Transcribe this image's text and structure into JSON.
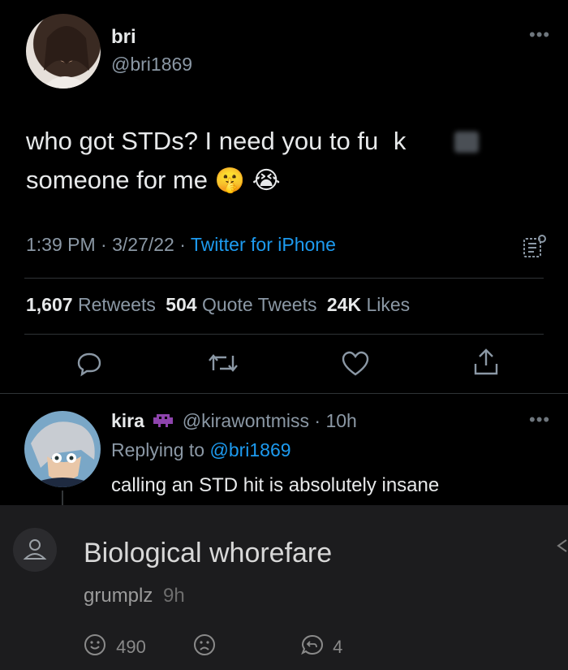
{
  "tweet": {
    "author_name": "bri",
    "author_handle": "@bri1869",
    "text_line1": "who got STDs? I need you to fu   k",
    "text_line2": "someone for me",
    "emoji": [
      "🤫",
      "😭"
    ],
    "time": "1:39 PM",
    "date": "3/27/22",
    "source": "Twitter for iPhone",
    "retweets_count": "1,607",
    "retweets_label": "Retweets",
    "quotes_count": "504",
    "quotes_label": "Quote Tweets",
    "likes_count": "24K",
    "likes_label": "Likes",
    "sep": "·"
  },
  "reply": {
    "author_name": "kira",
    "author_handle": "@kirawontmiss",
    "time": "10h",
    "replying_prefix": "Replying to",
    "replying_handle": "@bri1869",
    "text": "calling an STD hit is absolutely insane",
    "sep": "·"
  },
  "comment": {
    "text": "Biological whorefare",
    "author": "grumplz",
    "time": "9h",
    "upvotes": "490",
    "replies": "4"
  },
  "colors": {
    "accent": "#1d9bf0",
    "muted": "#8b98a5",
    "background": "#000000",
    "panel": "#1c1c1e"
  },
  "icons": [
    "more-icon",
    "analytics-icon",
    "reply-icon",
    "retweet-icon",
    "like-icon",
    "share-icon",
    "user-icon",
    "smile-icon",
    "frown-icon",
    "reply-count-icon"
  ]
}
